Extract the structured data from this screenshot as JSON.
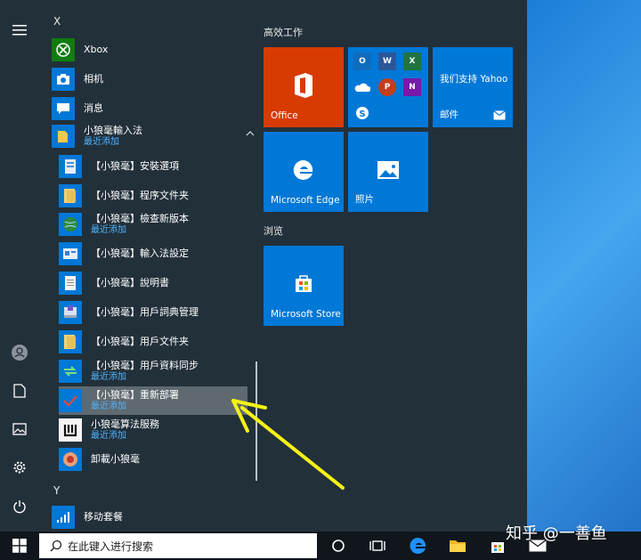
{
  "colors": {
    "menu_bg": "#22303a",
    "tile_blue": "#0078d7",
    "tile_office": "#d83b01",
    "recent_blue": "#4fb4ff",
    "annotation_yellow": "#f5f214"
  },
  "app_list": {
    "letter_x": "X",
    "letter_y": "Y",
    "items": [
      {
        "label": "Xbox",
        "icon": "xbox-icon"
      },
      {
        "label": "相机",
        "icon": "camera-icon"
      },
      {
        "label": "消息",
        "icon": "message-icon"
      },
      {
        "label": "小狼毫輸入法",
        "sub": "最近添加",
        "icon": "folder-icon"
      },
      {
        "label": "【小狼毫】安裝選項",
        "icon": "setup-icon"
      },
      {
        "label": "【小狼毫】程序文件夹",
        "icon": "folder-icon"
      },
      {
        "label": "【小狼毫】檢查新版本",
        "sub": "最近添加",
        "icon": "globe-icon"
      },
      {
        "label": "【小狼毫】輸入法設定",
        "icon": "settings-app-icon"
      },
      {
        "label": "【小狼毫】說明書",
        "icon": "document-icon"
      },
      {
        "label": "【小狼毫】用戶詞典管理",
        "icon": "dictionary-icon"
      },
      {
        "label": "【小狼毫】用戶文件夹",
        "icon": "folder-icon"
      },
      {
        "label": "【小狼毫】用戶資料同步",
        "sub": "最近添加",
        "icon": "sync-icon"
      },
      {
        "label": "【小狼毫】重新部署",
        "sub": "最近添加",
        "icon": "checkmark-icon"
      },
      {
        "label": "小狼毫算法服務",
        "sub": "最近添加",
        "icon": "weasel-service-icon"
      },
      {
        "label": "卸載小狼毫",
        "icon": "uninstall-icon"
      },
      {
        "label": "移动套餐",
        "icon": "signal-icon"
      }
    ]
  },
  "tiles": {
    "group_productivity": "高效工作",
    "group_browse": "浏览",
    "office": "Office",
    "yahoo_title": "我们支持 Yahoo",
    "mail": "邮件",
    "edge": "Microsoft Edge",
    "photos": "照片",
    "store": "Microsoft Store",
    "mini": {
      "outlook": "O",
      "word": "W",
      "excel": "X",
      "powerpoint": "P",
      "onenote": "N"
    }
  },
  "taskbar": {
    "search_placeholder": "在此键入进行搜索"
  },
  "watermark": "知乎 @一善鱼"
}
